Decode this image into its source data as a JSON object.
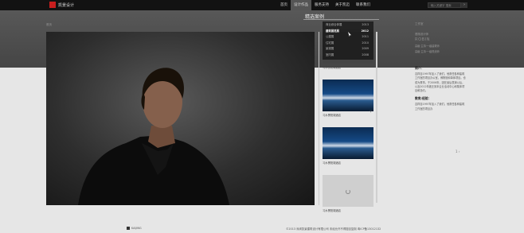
{
  "header": {
    "logo_text": "凯景设计",
    "nav": [
      "首页",
      "设计作品",
      "服务支持",
      "关于凯迈",
      "联系我们"
    ],
    "nav_active_index": 1,
    "search_placeholder": "输入关键字 搜索",
    "search_button": "›"
  },
  "band": {
    "title": "精选案例",
    "crumb_left": "首页",
    "crumb_right": "工作室"
  },
  "dropdown": [
    {
      "name": "商业综合体展",
      "year": "2013"
    },
    {
      "name": "建筑展览展",
      "year": "2012"
    },
    {
      "name": "公建展",
      "year": "2011"
    },
    {
      "name": "住宅展",
      "year": "2010"
    },
    {
      "name": "景观展",
      "year": "2009"
    },
    {
      "name": "室内展",
      "year": "2008"
    }
  ],
  "dropdown_selected_index": 1,
  "thumbnails": [
    {
      "caption": "习水黑阳湖酒店",
      "style": "dark"
    },
    {
      "caption": "习水黑阳湖酒店",
      "style": "night"
    },
    {
      "caption": "习水黑阳湖酒店",
      "style": "night"
    },
    {
      "caption": "习水黑阳湖酒店",
      "style": "loading"
    }
  ],
  "info": {
    "label": "首席设计师",
    "name": "ROBIN",
    "sub1": "高级·主持·一级建筑师",
    "sub2": "高级·主持·一级规划师",
    "intro_title": "简介：",
    "intro_text": "吉祥自1997年加入了我们。他曾任各种建筑工作室的项目办公室，博物馆和单体项目。也成为董事。于2006年，因在最后表演以后，以及2012年被迁到本企业活动中心和集体项目和协约。",
    "edu_title": "教育/经验：",
    "edu_text": "吉祥自1997年加入了我们。他曾任各种建筑工作室的项目办"
  },
  "pager": "1 ›",
  "footer": {
    "logo_text": "KAIJING",
    "copyright": "©2013 深圳凯景建筑设计有限公司 未经允许不得擅自复制 粤ICP备13012132"
  }
}
